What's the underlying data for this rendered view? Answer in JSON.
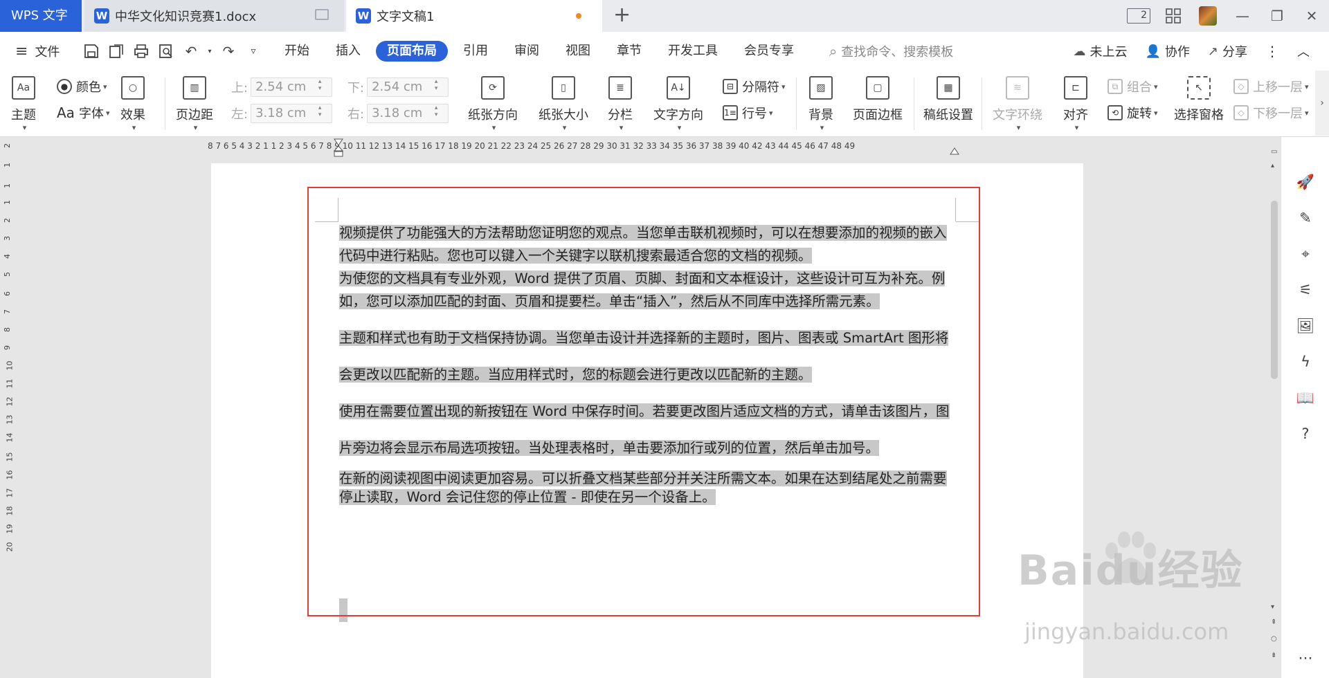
{
  "tabs": {
    "app_label": "WPS 文字",
    "doc1_icon": "W",
    "doc1_label": "中华文化知识竞赛1.docx",
    "doc2_icon": "W",
    "doc2_label": "文字文稿1",
    "new_tab": "+"
  },
  "window": {
    "layout_badge": "2",
    "minimize": "—",
    "restore": "❐",
    "close": "✕"
  },
  "menu": {
    "file_label": "文件",
    "tabs": [
      "开始",
      "插入",
      "页面布局",
      "引用",
      "审阅",
      "视图",
      "章节",
      "开发工具",
      "会员专享"
    ],
    "active_tab": "页面布局",
    "search_placeholder": "查找命令、搜索模板",
    "cloud_label": "未上云",
    "collab_label": "协作",
    "share_label": "分享"
  },
  "ribbon": {
    "theme": "主题",
    "color": "颜色",
    "font": "字体",
    "effect": "效果",
    "margins": "页边距",
    "margin_top_label": "上:",
    "margin_top": "2.54 cm",
    "margin_bottom_label": "下:",
    "margin_bottom": "2.54 cm",
    "margin_left_label": "左:",
    "margin_left": "3.18 cm",
    "margin_right_label": "右:",
    "margin_right": "3.18 cm",
    "orientation": "纸张方向",
    "paper_size": "纸张大小",
    "columns": "分栏",
    "text_direction": "文字方向",
    "separator": "分隔符",
    "line_number": "行号",
    "background": "背景",
    "page_border": "页面边框",
    "draft_setting": "稿纸设置",
    "text_wrap": "文字环绕",
    "align": "对齐",
    "group": "组合",
    "rotate": "旋转",
    "selection_pane": "选择窗格",
    "bring_forward": "上移一层",
    "send_backward": "下移一层"
  },
  "ruler": {
    "numbers": "8  7  6  5  4  3  2  1     1  2  3  4  5  6  7  8  9  10  11  12  13  14  15  16  17  18  19  20  21  22  23  24  25  26  27  28  29  30  31  32  33  34  35  36  37  38  39  40     42  43  44  45  46  47  48  49",
    "vertical": [
      "2",
      "1",
      "1",
      "1",
      "2",
      "3",
      "4",
      "5",
      "6",
      "7",
      "8",
      "9",
      "10",
      "11",
      "12",
      "13",
      "14",
      "15",
      "16",
      "17",
      "18",
      "19",
      "20"
    ]
  },
  "document": {
    "paragraphs": [
      "视频提供了功能强大的方法帮助您证明您的观点。当您单击联机视频时，可以在想要添加的视频的嵌入代码中进行粘贴。您也可以键入一个关键字以联机搜索最适合您的文档的视频。",
      "为使您的文档具有专业外观，Word 提供了页眉、页脚、封面和文本框设计，这些设计可互为补充。例如，您可以添加匹配的封面、页眉和提要栏。单击“插入”，然后从不同库中选择所需元素。",
      "主题和样式也有助于文档保持协调。当您单击设计并选择新的主题时，图片、图表或 SmartArt 图形将会更改以匹配新的主题。当应用样式时，您的标题会进行更改以匹配新的主题。",
      "使用在需要位置出现的新按钮在 Word 中保存时间。若要更改图片适应文档的方式，请单击该图片，图片旁边将会显示布局选项按钮。当处理表格时，单击要添加行或列的位置，然后单击加号。",
      "在新的阅读视图中阅读更加容易。可以折叠文档某些部分并关注所需文本。如果在达到结尾处之前需要停止读取，Word 会记住您的停止位置 - 即使在另一个设备上。"
    ],
    "line_spacing": [
      33,
      33,
      53,
      53,
      27
    ]
  },
  "watermark": {
    "main": "Baidu经验",
    "sub": "jingyan.baidu.com"
  },
  "colors": {
    "accent": "#2a62d9",
    "selection_border": "#e23b3b",
    "highlight": "#c8c8c8",
    "unsaved_dot": "#f08a24"
  },
  "icons": [
    "monitor-icon",
    "grid-icon",
    "save-icon",
    "undo-icon",
    "redo-icon",
    "search-icon",
    "cloud-icon",
    "rocket-icon",
    "pen-icon",
    "cursor-icon",
    "sliders-icon",
    "help-icon"
  ]
}
